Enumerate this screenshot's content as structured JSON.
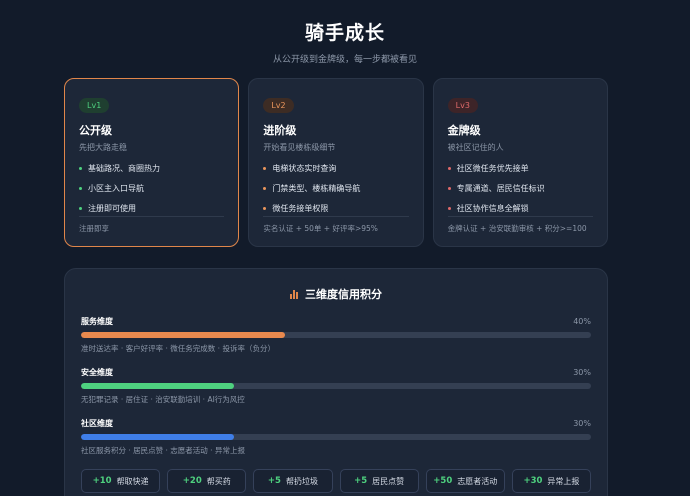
{
  "header": {
    "title": "骑手成长",
    "subtitle": "从公开级到金牌级，每一步都被看见"
  },
  "tiers": [
    {
      "badge": "Lv1",
      "badge_color": "#4ed17f",
      "badge_bg": "#1f3f30",
      "name": "公开级",
      "desc": "先把大路走稳",
      "items": [
        "基础路况、商圈热力",
        "小区主入口导航",
        "注册即可使用"
      ],
      "footer": "注册即享",
      "active": true
    },
    {
      "badge": "Lv2",
      "badge_color": "#e8955c",
      "badge_bg": "#3d2c24",
      "name": "进阶级",
      "desc": "开始看见楼栋级细节",
      "items": [
        "电梯状态实时查询",
        "门禁类型、楼栋精确导航",
        "微任务接单权限"
      ],
      "footer": "实名认证 + 50单 + 好评率>95%",
      "active": false
    },
    {
      "badge": "Lv3",
      "badge_color": "#e06a6a",
      "badge_bg": "#3d2428",
      "name": "金牌级",
      "desc": "被社区记住的人",
      "items": [
        "社区微任务优先接单",
        "专属通道、居民信任标识",
        "社区协作信息全解锁"
      ],
      "footer": "金牌认证 + 治安联勤审核 + 积分>=100",
      "active": false
    }
  ],
  "credit": {
    "title": "三维度信用积分",
    "dimensions": [
      {
        "name": "服务维度",
        "pct_label": "40%",
        "fraction": 0.4,
        "color": "#e8894e",
        "desc": "准时送达率 · 客户好评率 · 微任务完成数 · 投诉率（负分）"
      },
      {
        "name": "安全维度",
        "pct_label": "30%",
        "fraction": 0.3,
        "color": "#4ed17f",
        "desc": "无犯罪记录 · 居住证 · 治安联勤培训 · AI行为风控"
      },
      {
        "name": "社区维度",
        "pct_label": "30%",
        "fraction": 0.3,
        "color": "#3f7ee8",
        "desc": "社区服务积分 · 居民点赞 · 志愿者活动 · 异常上报"
      }
    ],
    "chips": [
      {
        "points": "+10",
        "label": "帮取快递"
      },
      {
        "points": "+20",
        "label": "帮买药"
      },
      {
        "points": "+5",
        "label": "帮扔垃圾"
      },
      {
        "points": "+5",
        "label": "居民点赞"
      },
      {
        "points": "+50",
        "label": "志愿者活动"
      },
      {
        "points": "+30",
        "label": "异常上报"
      }
    ]
  }
}
